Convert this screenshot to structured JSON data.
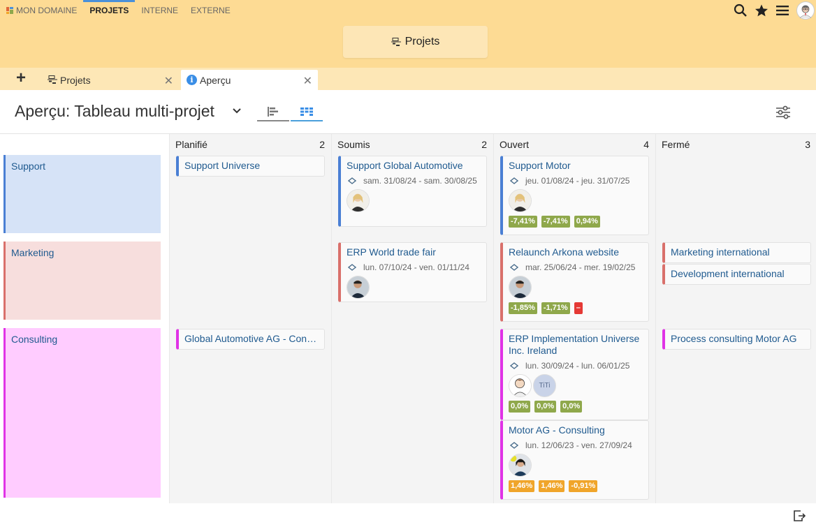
{
  "nav": {
    "items": [
      {
        "label": "MON DOMAINE"
      },
      {
        "label": "PROJETS"
      },
      {
        "label": "INTERNE"
      },
      {
        "label": "EXTERNE"
      }
    ],
    "title_button": "Projets",
    "icons": [
      "search-icon",
      "star-icon",
      "menu-icon",
      "user-avatar"
    ]
  },
  "tabs": [
    {
      "label": "Projets"
    },
    {
      "label": "Aperçu"
    }
  ],
  "page": {
    "title": "Aperçu: Tableau multi-projet"
  },
  "columns": [
    {
      "label": "Planifié",
      "count": "2"
    },
    {
      "label": "Soumis",
      "count": "2"
    },
    {
      "label": "Ouvert",
      "count": "4"
    },
    {
      "label": "Fermé",
      "count": "3"
    }
  ],
  "rows": [
    {
      "label": "Support",
      "color": "#4a7fd4",
      "bg": "#d6e3f7"
    },
    {
      "label": "Marketing",
      "color": "#d9706b",
      "bg": "#f7dedd"
    },
    {
      "label": "Consulting",
      "color": "#e033e6",
      "bg": "#ffccff"
    }
  ],
  "cards": {
    "support_universe": {
      "title": "Support Universe"
    },
    "support_global_automotive": {
      "title": "Support Global Automotive",
      "date": "sam. 31/08/24 - sam. 30/08/25"
    },
    "support_motor": {
      "title": "Support Motor",
      "date": "jeu. 01/08/24 - jeu. 31/07/25",
      "badges": [
        "-7,41%",
        "-7,41%",
        "0,94%"
      ]
    },
    "erp_world_trade_fair": {
      "title": "ERP World trade fair",
      "date": "lun. 07/10/24 - ven. 01/11/24"
    },
    "relaunch_arkona": {
      "title": "Relaunch Arkona website",
      "date": "mar. 25/06/24 - mer. 19/02/25",
      "badges": [
        "-1,85%",
        "-1,71%",
        "–"
      ]
    },
    "marketing_international": {
      "title": "Marketing international"
    },
    "development_international": {
      "title": "Development international"
    },
    "global_automotive_consulting": {
      "title": "Global Automotive AG - Consulting"
    },
    "erp_implementation": {
      "title": "ERP Implementation Universe Inc. Ireland",
      "date": "lun. 30/09/24 - lun. 06/01/25",
      "avatar_text": "TiTi",
      "badges": [
        "0,0%",
        "0,0%",
        "0,0%"
      ]
    },
    "motor_ag_consulting": {
      "title": "Motor AG - Consulting",
      "date": "lun. 12/06/23 - ven. 27/09/24",
      "badges": [
        "1,46%",
        "1,46%",
        "-0,91%"
      ]
    },
    "process_consulting": {
      "title": "Process consulting Motor AG"
    }
  },
  "colors": {
    "badge_green": "#8fa84b",
    "badge_red": "#e53935",
    "badge_orange": "#f0a52a",
    "accent_blue": "#4a90d9"
  }
}
